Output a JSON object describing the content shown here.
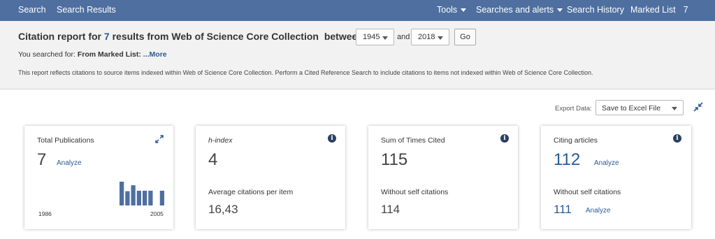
{
  "nav": {
    "search": "Search",
    "search_results": "Search Results",
    "tools": "Tools",
    "searches_alerts": "Searches and alerts",
    "search_history": "Search History",
    "marked_list": "Marked List",
    "marked_count": "7"
  },
  "header": {
    "title_prefix": "Citation report for",
    "result_count": "7",
    "title_mid": "results from Web of Science Core Collection",
    "between": "between",
    "year_from": "1945",
    "and": "and",
    "year_to": "2018",
    "go": "Go",
    "searched_label": "You searched for:",
    "searched_value": "From Marked List:",
    "more": "...More",
    "note": "This report reflects citations to source items indexed within Web of Science Core Collection. Perform a Cited Reference Search to include citations to items not indexed within Web of Science Core Collection."
  },
  "export": {
    "label": "Export Data:",
    "selected": "Save to Excel File"
  },
  "cards": {
    "publications": {
      "title": "Total Publications",
      "value": "7",
      "analyze": "Analyze",
      "year_start": "1986",
      "year_end": "2005"
    },
    "hindex": {
      "title": "h-index",
      "value": "4",
      "sub_title": "Average citations per item",
      "sub_value": "16,43"
    },
    "times_cited": {
      "title": "Sum of Times Cited",
      "value": "115",
      "sub_title": "Without self citations",
      "sub_value": "114"
    },
    "citing": {
      "title": "Citing articles",
      "value": "112",
      "analyze": "Analyze",
      "sub_title": "Without self citations",
      "sub_value": "111",
      "sub_analyze": "Analyze"
    }
  },
  "colors": {
    "nav_bg": "#4e6fa0",
    "link": "#2a5a94",
    "bar": "#4e6fa0",
    "info_icon": "#2a3f63"
  },
  "chart_data": {
    "type": "bar",
    "x_start": "1986",
    "x_end": "2005",
    "values": [
      1,
      0.6,
      0.85,
      0.62,
      0.62,
      0.62,
      0,
      0.62
    ]
  }
}
